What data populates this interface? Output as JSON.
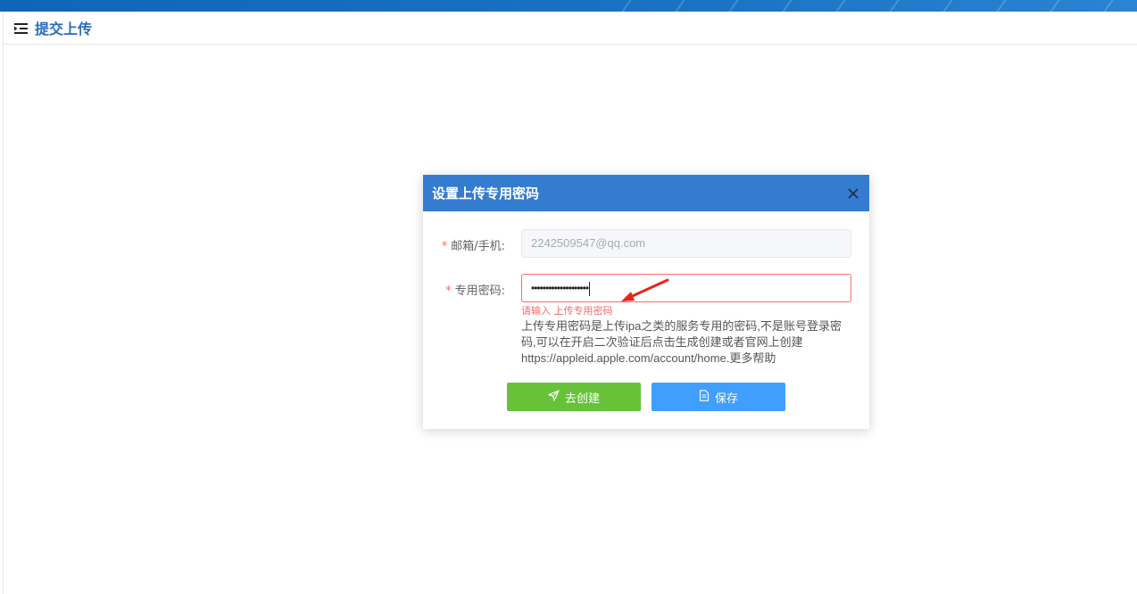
{
  "page": {
    "title": "提交上传",
    "icon": "menu-indent-icon"
  },
  "dialog": {
    "title": "设置上传专用密码",
    "close_icon": "close-icon",
    "email": {
      "label": "邮箱/手机:",
      "required_mark": "*",
      "value": "2242509547@qq.com"
    },
    "password": {
      "label": "专用密码:",
      "required_mark": "*",
      "masked_value": "••••••••••••••••••••",
      "error": "请输入 上传专用密码"
    },
    "help_text": "上传专用密码是上传ipa之类的服务专用的密码,不是账号登录密码,可以在开启二次验证后点击生成创建或者官网上创建https://appleid.apple.com/account/home.更多帮助",
    "buttons": {
      "create": {
        "label": "去创建",
        "icon": "send-icon"
      },
      "save": {
        "label": "保存",
        "icon": "document-icon"
      }
    }
  },
  "colors": {
    "top_bar": "#0f66b5",
    "dialog_header": "#347ccf",
    "title_text": "#2b6cb8",
    "error": "#f56c6c",
    "create_button": "#67c23a",
    "save_button": "#409eff",
    "annotation_arrow": "#e8231e"
  }
}
